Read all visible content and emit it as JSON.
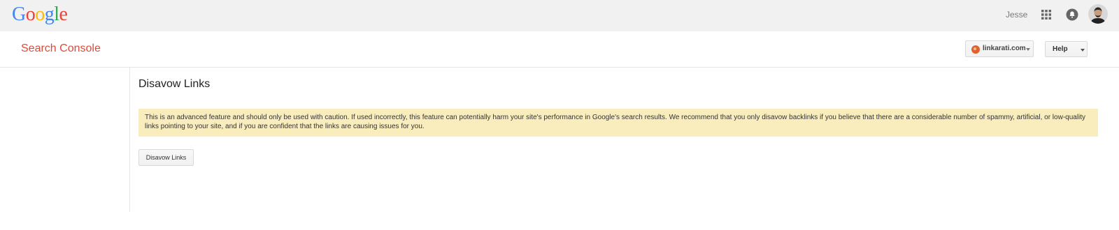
{
  "topbar": {
    "logo_letters": [
      "G",
      "o",
      "o",
      "g",
      "l",
      "e"
    ],
    "user_name": "Jesse",
    "icons": [
      "apps-grid-icon",
      "notifications-icon",
      "avatar"
    ]
  },
  "header": {
    "app_title": "Search Console",
    "site_picker_label": "linkarati.com",
    "help_label": "Help"
  },
  "main": {
    "page_title": "Disavow Links",
    "warning_text": "This is an advanced feature and should only be used with caution. If used incorrectly, this feature can potentially harm your site's performance in Google's search results. We recommend that you only disavow backlinks if you believe that there are a considerable number of spammy, artificial, or low-quality links pointing to your site, and if you are confident that the links are causing issues for you.",
    "disavow_button_label": "Disavow Links"
  },
  "colors": {
    "topbar_bg": "#f1f1f1",
    "app_title": "#dd4b39",
    "warning_bg": "#f9edbe"
  }
}
